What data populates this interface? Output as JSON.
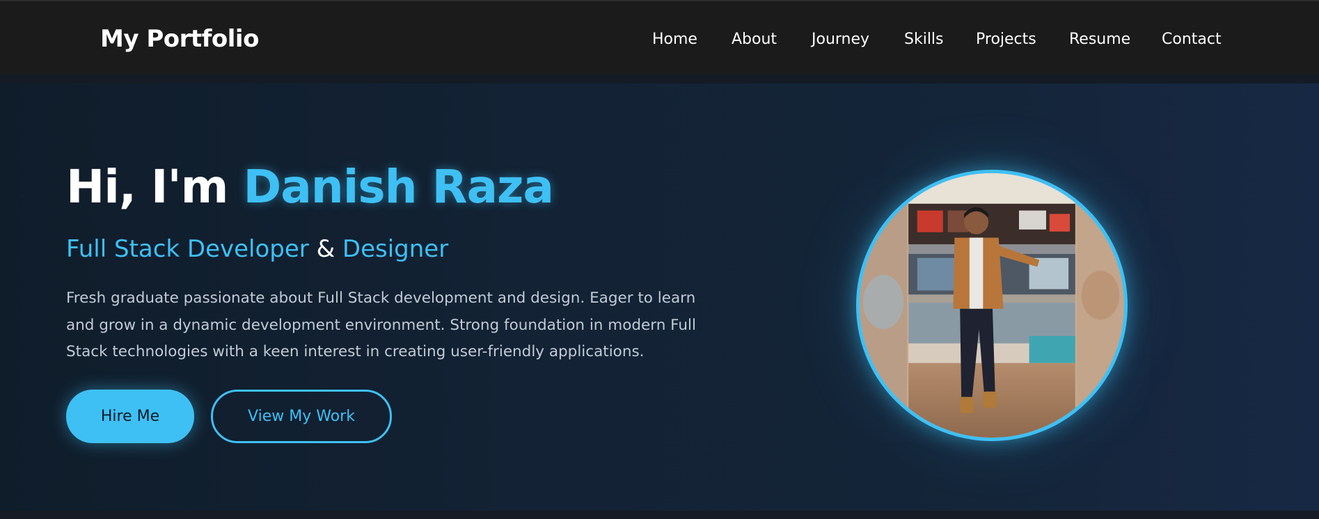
{
  "nav": {
    "brand": "My Portfolio",
    "links": [
      "Home",
      "About",
      "Journey",
      "Skills",
      "Projects",
      "Resume",
      "Contact"
    ]
  },
  "hero": {
    "greeting": "Hi, I'm",
    "name": "Danish Raza",
    "role_primary": "Full Stack Developer",
    "role_joiner": "&",
    "role_secondary": "Designer",
    "description": "Fresh graduate passionate about Full Stack development and design. Eager to learn and grow in a dynamic development environment. Strong foundation in modern Full Stack technologies with a keen interest in creating user-friendly applications.",
    "hire_button": "Hire Me",
    "work_button": "View My Work"
  },
  "theme": {
    "accent": "#3ec0f5",
    "nav_bg": "#1b1b1b",
    "hero_bg": "#132234"
  }
}
